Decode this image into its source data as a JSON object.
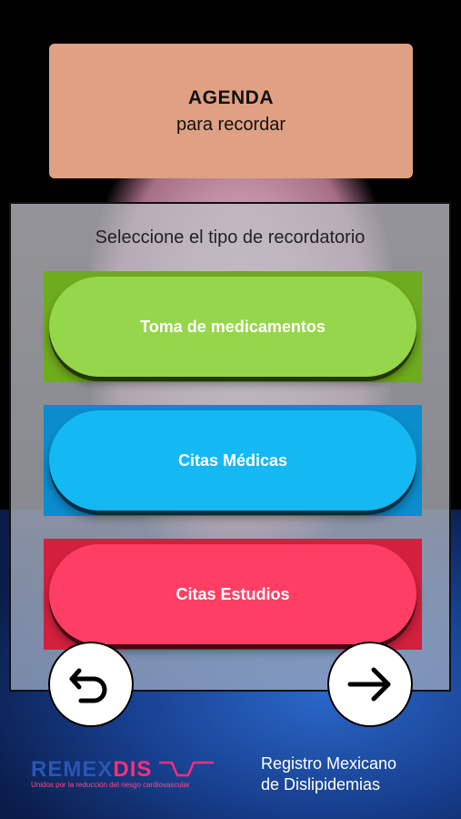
{
  "header": {
    "title": "AGENDA",
    "subtitle": "para recordar"
  },
  "panel": {
    "caption": "Seleccione el tipo de recordatorio",
    "options": [
      {
        "label": "Toma de medicamentos",
        "color": "#96d64a",
        "frame_color": "#6fab1e"
      },
      {
        "label": "Citas Médicas",
        "color": "#14b8f2",
        "frame_color": "#0a8ccd"
      },
      {
        "label": "Citas Estudios",
        "color": "#ff3e63",
        "frame_color": "#d3203f"
      }
    ]
  },
  "nav": {
    "back_icon": "undo-arrow-icon",
    "next_icon": "right-arrow-icon"
  },
  "footer": {
    "logo_part1": "REMEX",
    "logo_part2": "DIS",
    "logo_tagline": "Unidos por la reducción del riesgo cardiovascular",
    "registry_line1": "Registro Mexicano",
    "registry_line2": "de Dislipidemias",
    "brand_blue": "#2a55b5",
    "brand_pink": "#ff2d7a"
  }
}
